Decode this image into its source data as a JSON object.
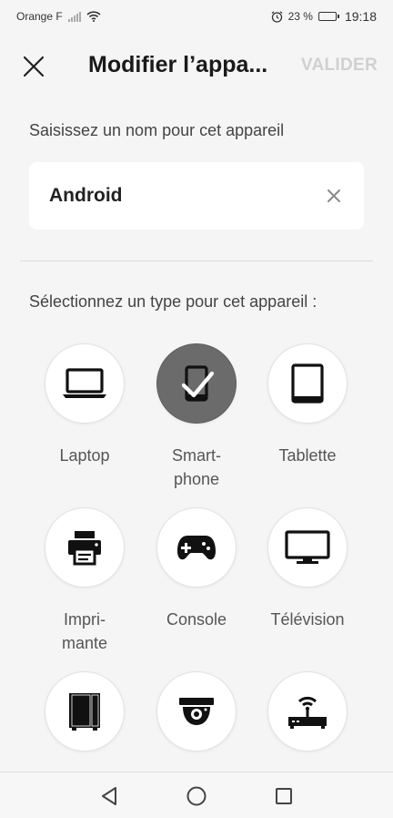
{
  "status": {
    "carrier": "Orange F",
    "battery": "23 %",
    "battery_level": 0.23,
    "time": "19:18",
    "icons": [
      "signal-icon",
      "wifi-icon",
      "alarm-icon",
      "battery-icon"
    ]
  },
  "header": {
    "title": "Modifier l’appa...",
    "validate_label": "VALIDER",
    "close_icon": "close-icon"
  },
  "name_section": {
    "prompt": "Saisissez un nom pour cet appareil",
    "value": "Android",
    "clear_icon": "clear-icon"
  },
  "type_section": {
    "prompt": "Sélectionnez un type pour cet appareil :",
    "selected": "Smartphone",
    "devices": [
      {
        "label": "Laptop",
        "icon": "laptop-icon"
      },
      {
        "label": "Smart-\nphone",
        "icon": "smartphone-icon"
      },
      {
        "label": "Tablette",
        "icon": "tablet-icon"
      },
      {
        "label": "Impri-\nmante",
        "icon": "printer-icon"
      },
      {
        "label": "Console",
        "icon": "gamepad-icon"
      },
      {
        "label": "Télévision",
        "icon": "tv-icon"
      },
      {
        "label": "",
        "icon": "server-icon"
      },
      {
        "label": "",
        "icon": "camera-icon"
      },
      {
        "label": "",
        "icon": "router-icon"
      }
    ]
  },
  "colors": {
    "background": "#f5f5f5",
    "selected_circle": "#6b6b6b",
    "validate_disabled": "#d0d0d0"
  },
  "nav": {
    "icons": [
      "back-icon",
      "home-icon",
      "recents-icon"
    ]
  }
}
